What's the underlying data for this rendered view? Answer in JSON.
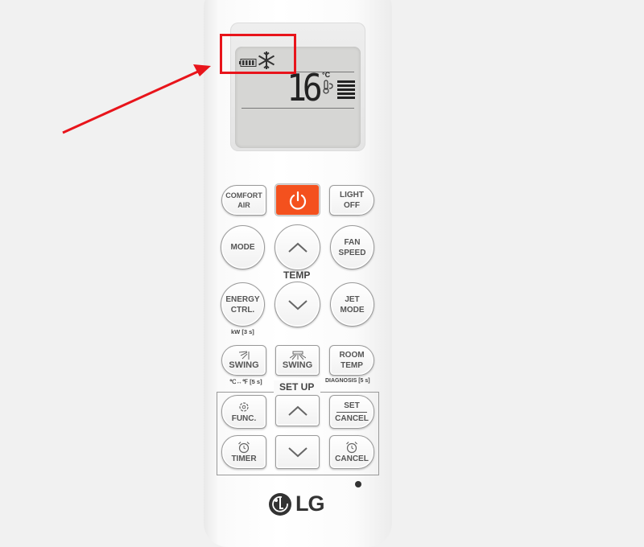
{
  "display": {
    "temperature": "16",
    "unit": "°C",
    "icons": [
      "battery-icon",
      "snowflake-cool-mode-icon",
      "thermometer-icon",
      "fan-speed-bars-icon"
    ],
    "fan_level_bars": 5
  },
  "annotation": {
    "highlight_color": "#e8141b",
    "highlighted": "battery and cool-mode indicators"
  },
  "buttons": {
    "comfort_air": [
      "COMFORT",
      "AIR"
    ],
    "power_color": "#f4511e",
    "light_off": [
      "LIGHT",
      "OFF"
    ],
    "mode": "MODE",
    "fan_speed": [
      "FAN",
      "SPEED"
    ],
    "temp_label": "TEMP",
    "energy_ctrl": [
      "ENERGY",
      "CTRL."
    ],
    "energy_sub": "kW [3 s]",
    "jet_mode": [
      "JET",
      "MODE"
    ],
    "swing_vertical": "SWING",
    "swing_vertical_sub": "℃↔℉ [5 s]",
    "swing_horizontal": "SWING",
    "room_temp": [
      "ROOM",
      "TEMP"
    ],
    "room_temp_sub": "DIAGNOSIS [5 s]",
    "setup_label": "SET UP",
    "func": "FUNC.",
    "set_cancel": [
      "SET",
      "CANCEL"
    ],
    "timer": "TIMER",
    "cancel": "CANCEL"
  },
  "brand": "LG"
}
